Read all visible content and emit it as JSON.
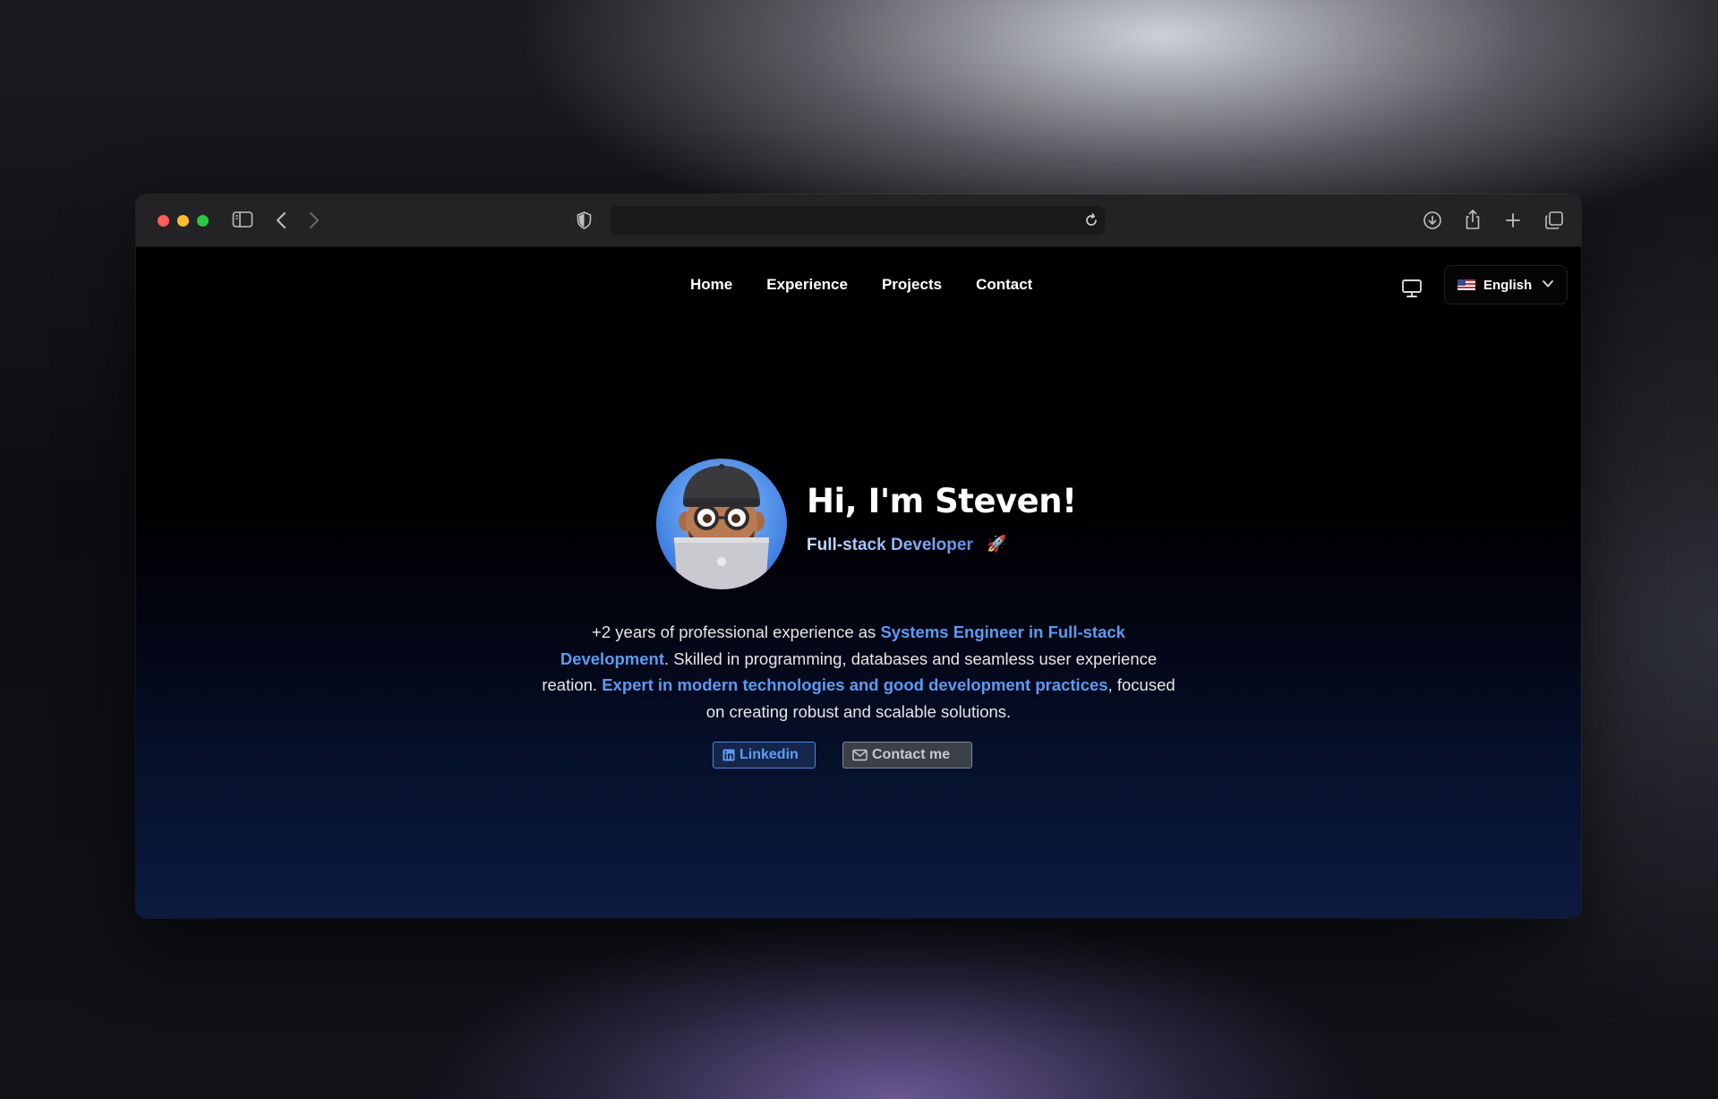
{
  "nav": {
    "links": [
      "Home",
      "Experience",
      "Projects",
      "Contact"
    ]
  },
  "language": {
    "selected": "English"
  },
  "hero": {
    "title": "Hi, I'm Steven!",
    "subtitle": "Full-stack Developer",
    "subtitle_emoji": "🚀",
    "bio": {
      "p1": "+2 years of professional experience as ",
      "h1": "Systems Engineer in Full-stack Development",
      "p2": ". Skilled in programming, databases and seamless user experience reation. ",
      "h2": "Expert in modern technologies and good development practices",
      "p3": ", focused on creating robust and scalable solutions."
    }
  },
  "buttons": {
    "linkedin": "Linkedin",
    "contact": "Contact me"
  },
  "colors": {
    "accent": "#5a9bf5",
    "page_bg": "#000000",
    "traffic_red": "#fe5f57",
    "traffic_yellow": "#febc2e",
    "traffic_green": "#28c840"
  }
}
